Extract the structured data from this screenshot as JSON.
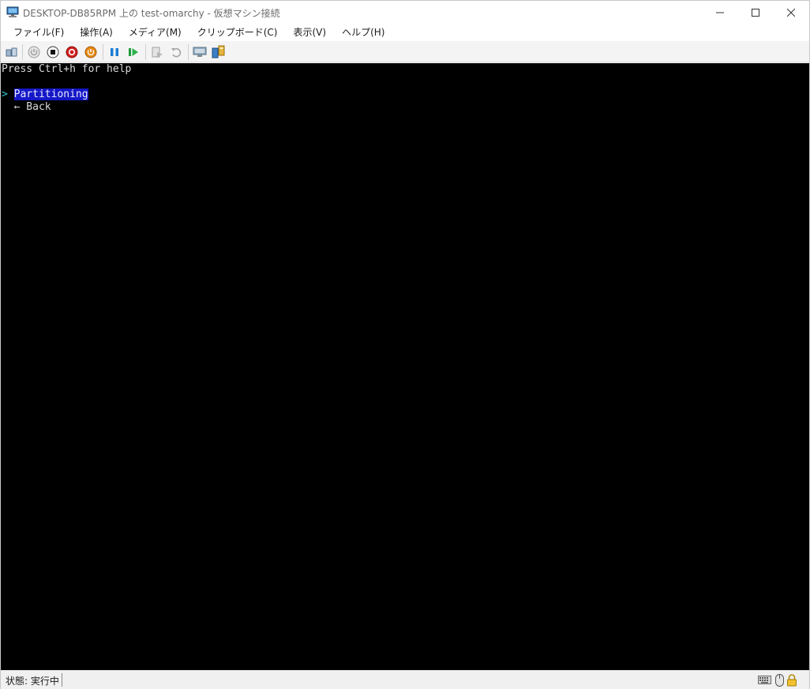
{
  "window": {
    "title": "DESKTOP-DB85RPM 上の test-omarchy - 仮想マシン接続"
  },
  "menu": {
    "items": [
      "ファイル(F)",
      "操作(A)",
      "メディア(M)",
      "クリップボード(C)",
      "表示(V)",
      "ヘルプ(H)"
    ]
  },
  "toolbar": {
    "icons": [
      "ctrl-alt-del-icon",
      "start-icon",
      "turn-off-icon",
      "shutdown-icon",
      "save-icon",
      "pause-icon",
      "resume-icon",
      "checkpoint-icon",
      "revert-icon",
      "enhanced-session-icon",
      "share-icon"
    ]
  },
  "console": {
    "help_line": "Press Ctrl+h for help",
    "cursor": ">",
    "selected_item": "Partitioning",
    "back_item": "← Back"
  },
  "status": {
    "text": "状態: 実行中",
    "icons": [
      "keyboard-icon",
      "mouse-icon",
      "lock-icon"
    ]
  },
  "colors": {
    "console_bg": "#000000",
    "console_fg": "#d9d9d9",
    "selection_bg": "#1418c6",
    "cursor_color": "#2fc6d6"
  }
}
